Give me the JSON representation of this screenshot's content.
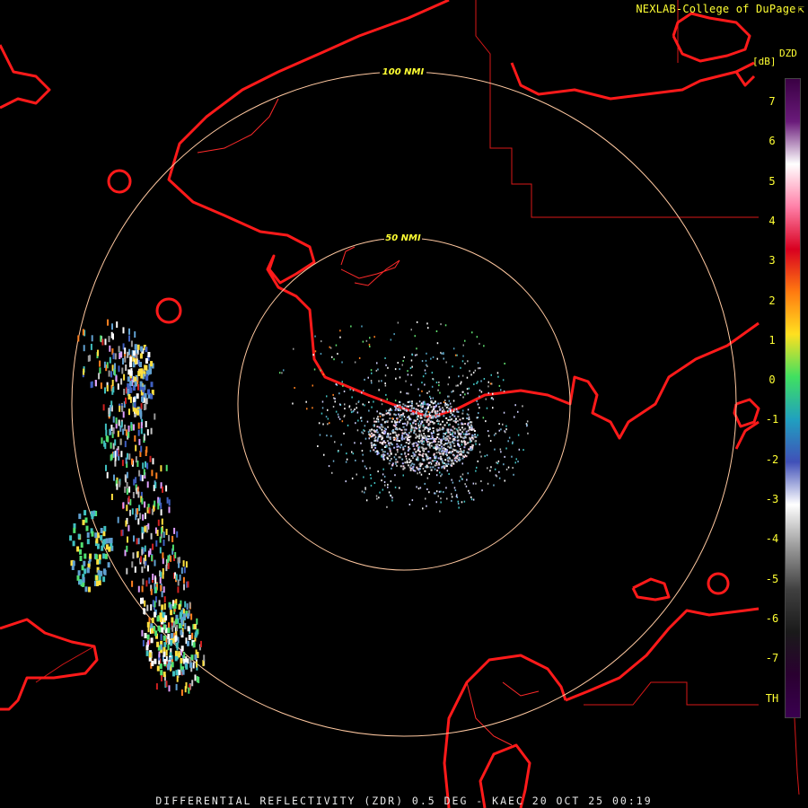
{
  "header": {
    "credit": "NEXLAB-College of DuPage",
    "product_code": "DZD",
    "unit": "[dB]"
  },
  "range_rings": [
    {
      "label": "100 NMI"
    },
    {
      "label": "50 NMI"
    }
  ],
  "colorbar": {
    "ticks": [
      "7",
      "6",
      "5",
      "4",
      "3",
      "2",
      "1",
      "0",
      "-1",
      "-2",
      "-3",
      "-4",
      "-5",
      "-6",
      "-7",
      "TH"
    ],
    "gradient_stops": [
      "#3a0044",
      "#6a1a7a",
      "#ffffff",
      "#ff80a8",
      "#d80020",
      "#ff7a10",
      "#ffe020",
      "#40e060",
      "#20a0c0",
      "#4050b8",
      "#ffffff",
      "#9a9a9a",
      "#404040",
      "#1a1a1a",
      "#2a0030",
      "#3a0050"
    ]
  },
  "colors": {
    "coastline": "#ff1a1a",
    "ring": "#ffc8a0",
    "label": "#ffff33"
  },
  "footer": {
    "caption": "DIFFERENTIAL REFLECTIVITY (ZDR) 0.5 DEG - KAEC 20 OCT 25 00:19"
  }
}
